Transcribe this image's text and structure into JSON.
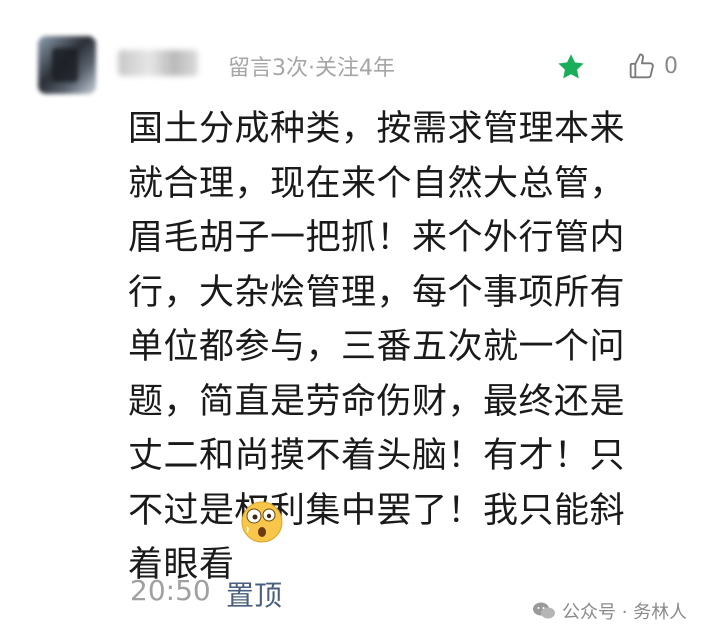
{
  "comment": {
    "meta": "留言3次·关注4年",
    "like_count": "0",
    "lines": [
      "国土分成种类，按需求管理本来",
      "就合理，现在来个自然大总管，",
      "眉毛胡子一把抓！来个外行管内",
      "行，大杂烩管理，每个事项所有",
      "单位都参与，三番五次就一个问",
      "题，简直是劳命伤财，最终还是",
      "丈二和尚摸不着头脑！有才！只",
      "不过是权利集中罢了！我只能斜",
      "着眼看"
    ],
    "time": "20:50",
    "pin_label": "置顶"
  },
  "watermark": {
    "text": "公众号 · 务林人"
  },
  "colors": {
    "star": "#1aad5a",
    "pin": "#4a5f7d",
    "meta": "#a6a6a6"
  },
  "icons": {
    "star": "star-icon",
    "like": "thumbs-up-icon",
    "emoji": "shocked-face-emoji",
    "watermark": "wechat-icon"
  }
}
